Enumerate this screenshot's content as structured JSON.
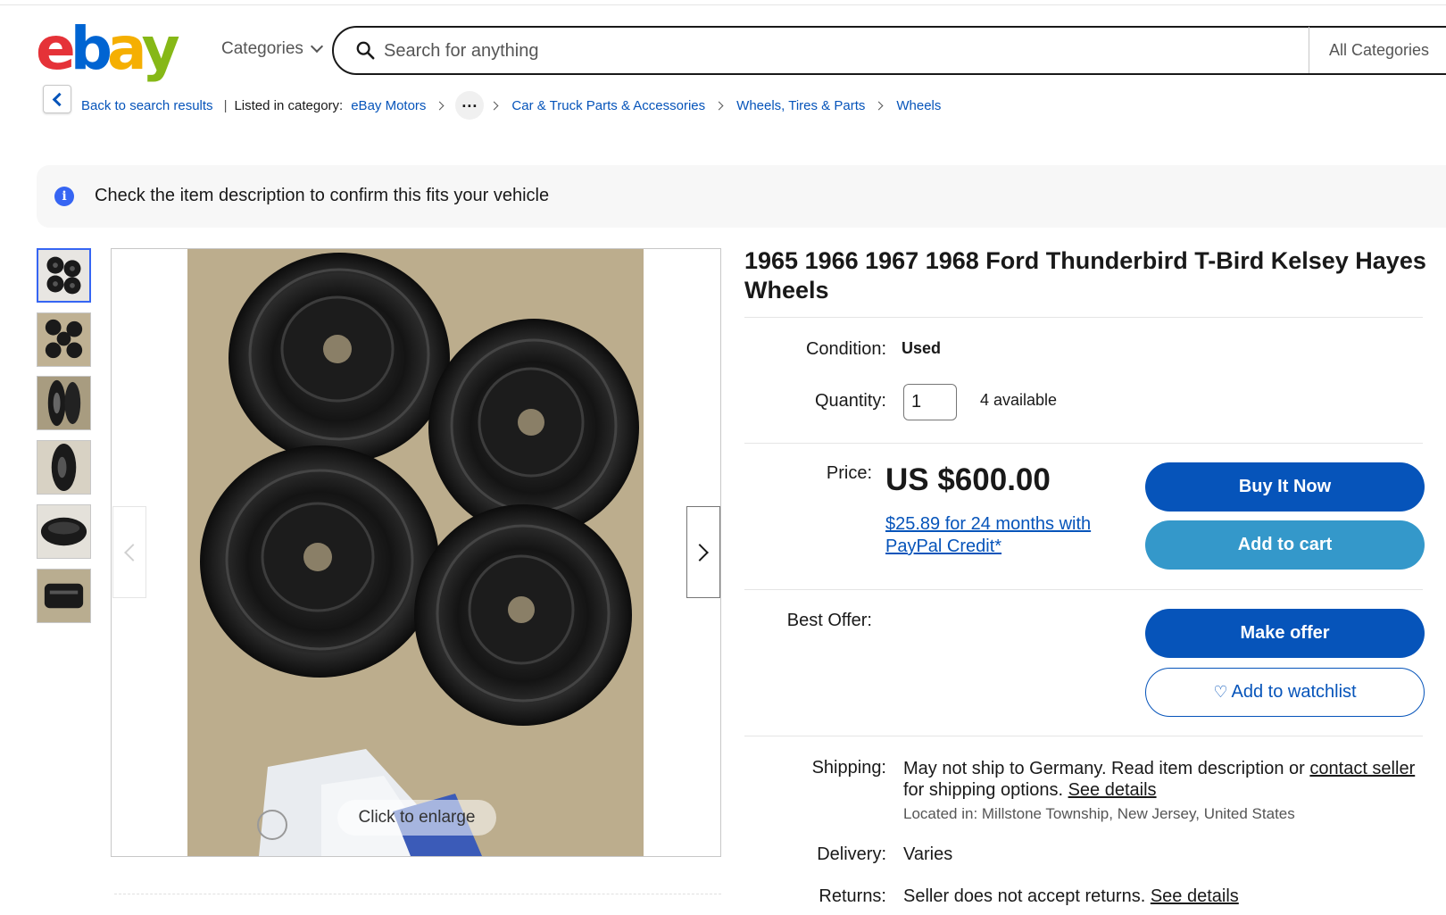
{
  "header": {
    "logo_letters": [
      "e",
      "b",
      "a",
      "y"
    ],
    "categories_label": "Categories",
    "search_placeholder": "Search for anything",
    "all_categories": "All Categories"
  },
  "breadcrumb": {
    "back_label": "Back to search results",
    "separator": "|",
    "listed_label": "Listed in category:",
    "items": [
      "eBay Motors",
      "Car & Truck Parts & Accessories",
      "Wheels, Tires & Parts",
      "Wheels"
    ],
    "more": "..."
  },
  "notice": {
    "icon": "info-icon",
    "icon_glyph": "i",
    "text": "Check the item description to confirm this fits your vehicle"
  },
  "gallery": {
    "thumbnail_count": 6,
    "selected_index": 0,
    "enlarge_label": "Click to enlarge"
  },
  "item": {
    "title": "1965 1966 1967 1968 Ford Thunderbird T-Bird Kelsey Hayes Wheels",
    "condition_label": "Condition:",
    "condition_value": "Used",
    "quantity_label": "Quantity:",
    "quantity_value": "1",
    "available": "4 available",
    "price_label": "Price:",
    "price": "US $600.00",
    "paypal_credit": "$25.89 for 24 months with PayPal Credit*",
    "best_offer_label": "Best Offer:"
  },
  "buttons": {
    "buy_now": "Buy It Now",
    "add_to_cart": "Add to cart",
    "make_offer": "Make offer",
    "watchlist": "Add to watchlist"
  },
  "shipping": {
    "label": "Shipping:",
    "text_1": "May not ship to Germany. Read item description or",
    "contact_link": "contact seller",
    "text_2": "for shipping options.",
    "see_details": "See details",
    "located": "Located in: Millstone Township, New Jersey, United States"
  },
  "delivery": {
    "label": "Delivery:",
    "value": "Varies"
  },
  "returns": {
    "label": "Returns:",
    "value": "Seller does not accept returns.",
    "see_details": "See details"
  },
  "colors": {
    "ebay_red": "#e53238",
    "ebay_blue": "#0064d2",
    "ebay_yellow": "#f5af02",
    "ebay_green": "#86b817",
    "primary_button": "#0654ba",
    "secondary_button": "#3498ca",
    "link": "#0654ba"
  }
}
